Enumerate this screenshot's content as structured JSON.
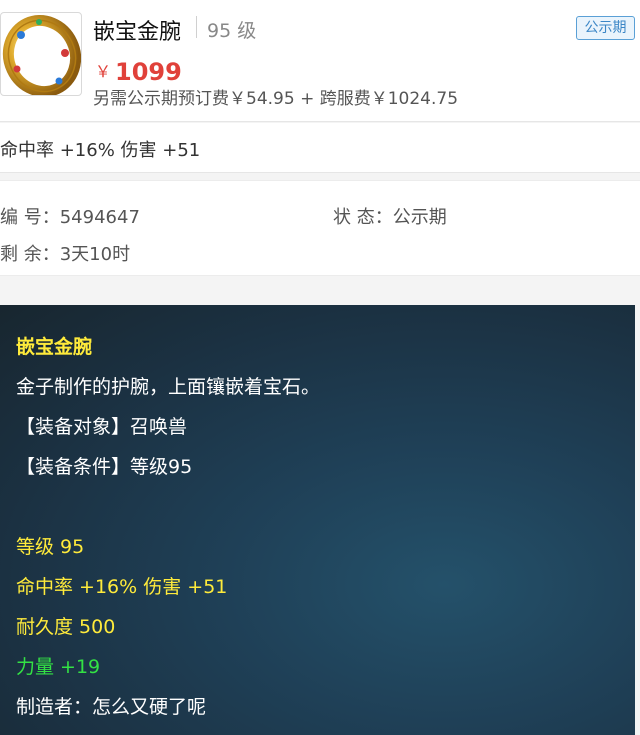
{
  "item": {
    "name": "嵌宝金腕",
    "level": "95 级",
    "status_badge": "公示期",
    "price_symbol": "￥",
    "price": "1099",
    "fees": "另需公示期预订费￥54.95 + 跨服费￥1024.75"
  },
  "attributes_summary": "命中率 +16% 伤害 +51",
  "meta": {
    "id_label": "编 号：",
    "id_value": "5494647",
    "status_label": "状 态：",
    "status_value": "公示期",
    "remaining_label": "剩 余：",
    "remaining_value": "3天10时"
  },
  "tooltip": {
    "title": "嵌宝金腕",
    "description": "金子制作的护腕，上面镶嵌着宝石。",
    "target": "【装备对象】召唤兽",
    "requirement": "【装备条件】等级95",
    "level": "等级 95",
    "hit_damage": "命中率 +16% 伤害 +51",
    "durability": "耐久度 500",
    "strength": "力量 +19",
    "maker": "制造者：怎么又硬了呢"
  },
  "colors": {
    "price": "#e0413a",
    "badge": "#3b86c6",
    "tooltip_yellow": "#ffeb3b",
    "tooltip_green": "#33e244",
    "tooltip_bg": "#1f4057"
  }
}
